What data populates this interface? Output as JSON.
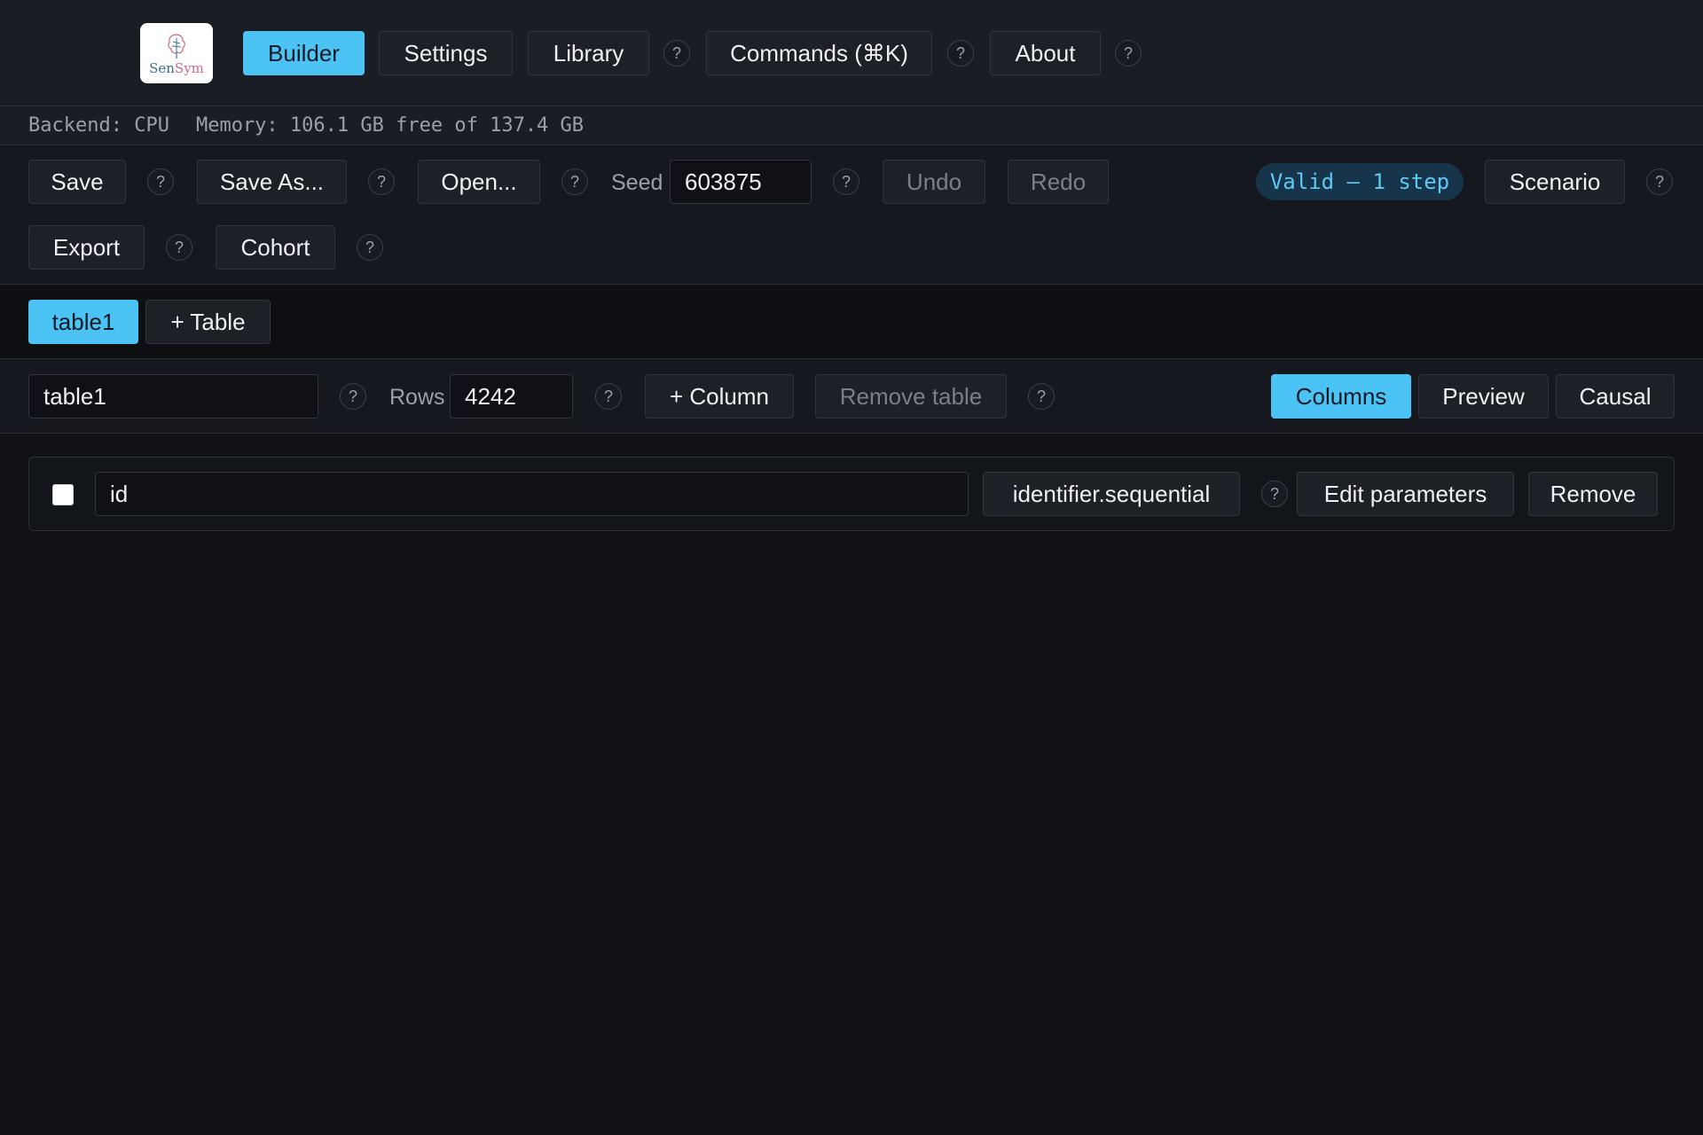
{
  "nav": {
    "logo_text_sen": "Sen",
    "logo_text_sym": "Sym",
    "builder": "Builder",
    "settings": "Settings",
    "library": "Library",
    "commands": "Commands (⌘K)",
    "about": "About",
    "help": "?"
  },
  "status": {
    "backend": "Backend: CPU",
    "memory": "Memory: 106.1 GB free of 137.4 GB"
  },
  "toolbar": {
    "save": "Save",
    "save_as": "Save As...",
    "open": "Open...",
    "seed_label": "Seed",
    "seed_value": "603875",
    "undo": "Undo",
    "redo": "Redo",
    "valid_badge": "Valid — 1 step",
    "scenario": "Scenario",
    "export": "Export",
    "cohort": "Cohort"
  },
  "tabs": {
    "active_table": "table1",
    "add_table": "+ Table"
  },
  "table_bar": {
    "table_name": "table1",
    "rows_label": "Rows",
    "rows_value": "4242",
    "add_column": "+ Column",
    "remove_table": "Remove table",
    "view_columns": "Columns",
    "view_preview": "Preview",
    "view_causal": "Causal"
  },
  "columns": [
    {
      "name": "id",
      "type": "identifier.sequential",
      "edit_label": "Edit parameters",
      "remove_label": "Remove",
      "checked": false
    }
  ],
  "colors": {
    "accent": "#4cc3f5",
    "background": "#0f1116",
    "panel": "#1a1d24",
    "badge_bg": "#16354a",
    "badge_text": "#5fc8f5"
  }
}
